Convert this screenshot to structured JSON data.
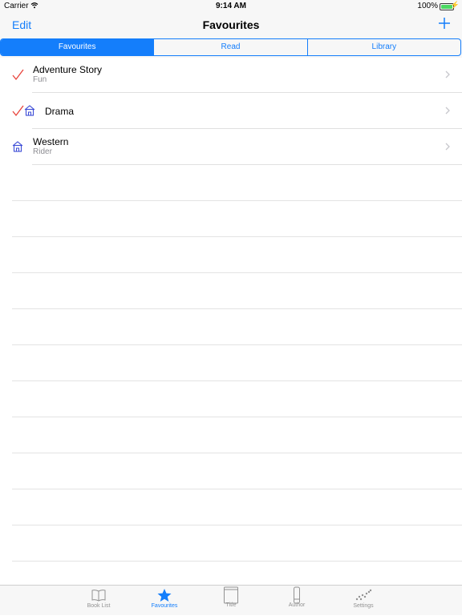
{
  "status_bar": {
    "carrier": "Carrier",
    "time": "9:14 AM",
    "battery": "100%",
    "battery_level": 1.0
  },
  "nav": {
    "left_button": "Edit",
    "title": "Favourites",
    "right_icon": "plus-icon"
  },
  "segments": [
    {
      "label": "Favourites",
      "selected": true
    },
    {
      "label": "Read",
      "selected": false
    },
    {
      "label": "Library",
      "selected": false
    }
  ],
  "rows": [
    {
      "title": "Adventure Story",
      "subtitle": "Fun",
      "icons": [
        "checkmark-icon"
      ]
    },
    {
      "title": "Drama",
      "subtitle": "",
      "icons": [
        "checkmark-icon",
        "house-icon"
      ]
    },
    {
      "title": "Western",
      "subtitle": "Rider",
      "icons": [
        "house-icon"
      ]
    }
  ],
  "tabs": [
    {
      "label": "Book List",
      "icon": "book-icon",
      "selected": false
    },
    {
      "label": "Favourites",
      "icon": "star-icon",
      "selected": true
    },
    {
      "label": "Title",
      "icon": "title-icon",
      "selected": false
    },
    {
      "label": "Author",
      "icon": "author-icon",
      "selected": false
    },
    {
      "label": "Settings",
      "icon": "settings-icon",
      "selected": false
    }
  ],
  "colors": {
    "accent": "#147efb",
    "check": "#e8423a",
    "house": "#3b4bd6",
    "inactive": "#929292"
  }
}
